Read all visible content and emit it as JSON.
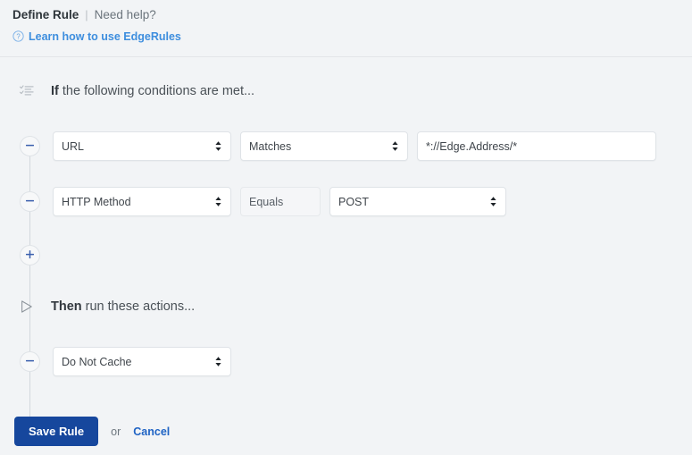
{
  "header": {
    "title": "Define Rule",
    "separator": "|",
    "need_help": "Need help?",
    "help_icon": "question-circle-icon",
    "help_link": "Learn how to use EdgeRules"
  },
  "colors": {
    "page_background": "#f2f4f6",
    "field_background": "#ffffff",
    "field_border": "#dfe3e7",
    "readonly_background": "#f5f6f8",
    "primary_button": "#16479d",
    "link_blue": "#1f63c4",
    "help_link_blue": "#3e8ede",
    "rail_line": "#d3d8dd",
    "accent_minus": "#3a5fad"
  },
  "conditions_section": {
    "icon": "checklist-icon",
    "label_bold": "If",
    "label_rest": " the following conditions are met...",
    "remove_icon": "minus-icon",
    "add_icon": "plus-icon",
    "add_button_label": "",
    "rows": [
      {
        "subject": {
          "value": "URL",
          "type": "select",
          "icon": "chevron-updown-icon"
        },
        "operator": {
          "value": "Matches",
          "type": "select",
          "icon": "chevron-updown-icon"
        },
        "value_field": {
          "value": "*://Edge.Address/*",
          "type": "text",
          "placeholder": ""
        }
      },
      {
        "subject": {
          "value": "HTTP Method",
          "type": "select",
          "icon": "chevron-updown-icon"
        },
        "operator": {
          "value": "Equals",
          "type": "readonly"
        },
        "value_field": {
          "value": "POST",
          "type": "select",
          "icon": "chevron-updown-icon"
        }
      }
    ]
  },
  "actions_section": {
    "icon": "play-triangle-icon",
    "label_bold": "Then",
    "label_rest": " run these actions...",
    "remove_icon": "minus-icon",
    "rows": [
      {
        "action": {
          "value": "Do Not Cache",
          "type": "select",
          "icon": "chevron-updown-icon"
        }
      }
    ]
  },
  "footer": {
    "save_label": "Save Rule",
    "or_label": "or",
    "cancel_label": "Cancel"
  }
}
